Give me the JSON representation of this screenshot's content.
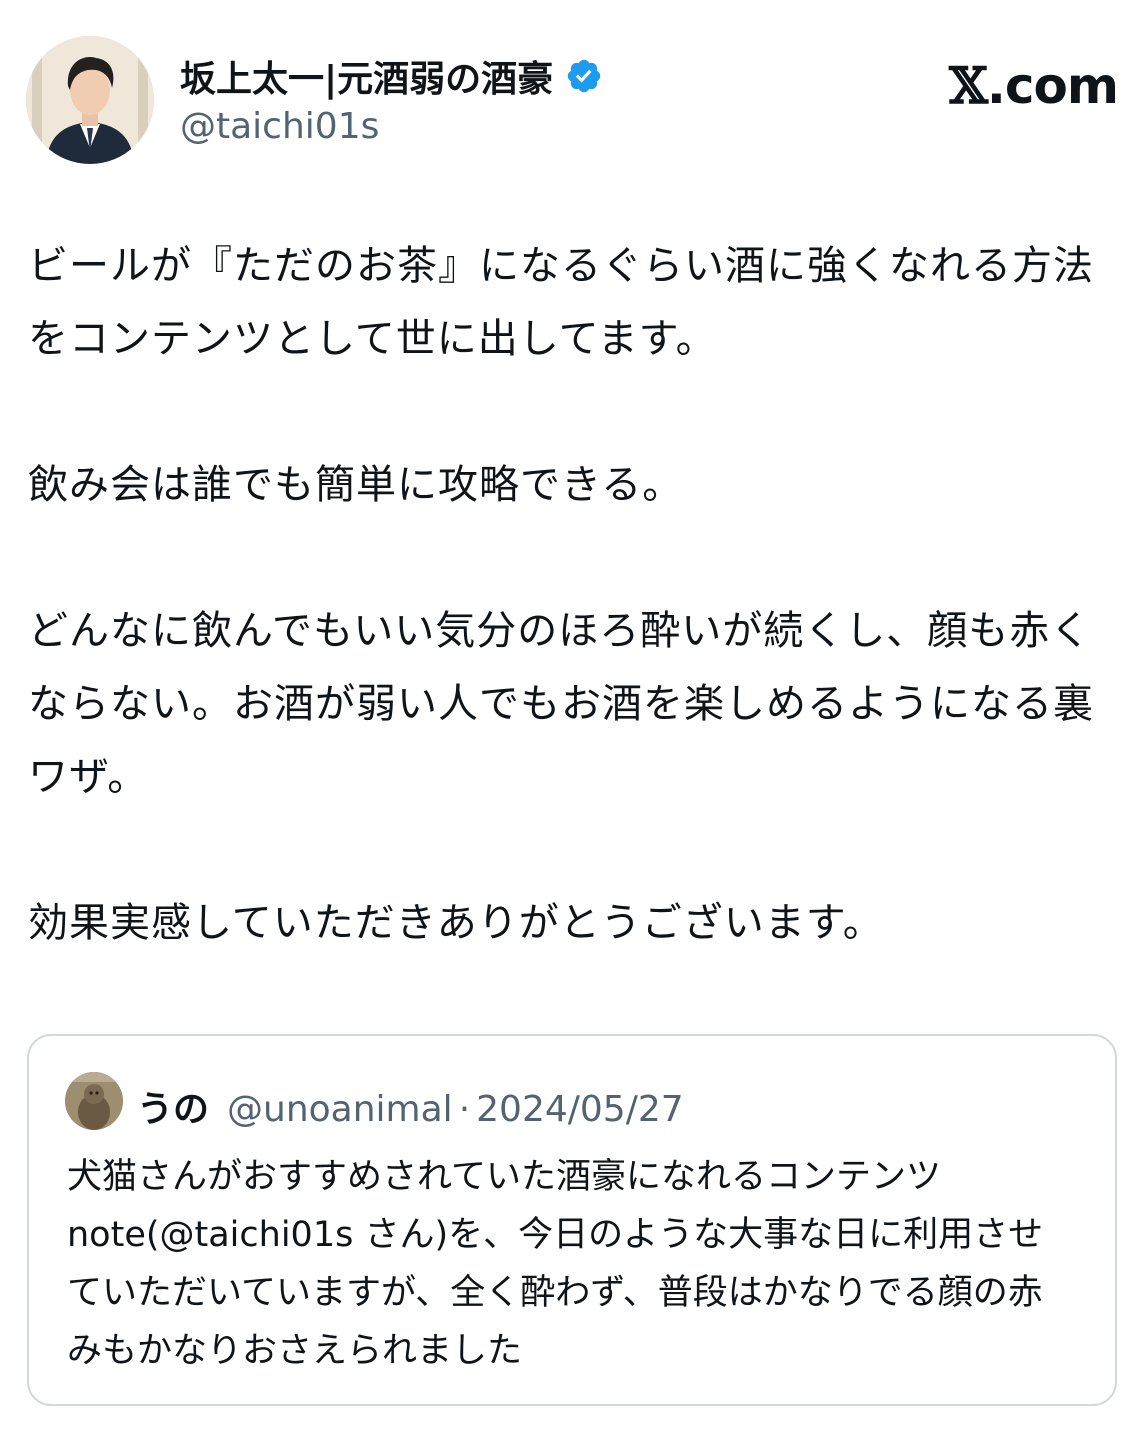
{
  "author": {
    "name": "坂上太一|元酒弱の酒豪",
    "handle": "@taichi01s",
    "verified_color": "#1d9bf0"
  },
  "brand": {
    "x_glyph": "𝕏",
    "domain": ".com"
  },
  "tweet": {
    "text": "ビールが『ただのお茶』になるぐらい酒に強くなれる方法をコンテンツとして世に出してます。\n\n飲み会は誰でも簡単に攻略できる。\n\nどんなに飲んでもいい気分のほろ酔いが続くし、顔も赤くならない。お酒が弱い人でもお酒を楽しめるようになる裏ワザ。\n\n効果実感していただきありがとうございます。"
  },
  "quoted": {
    "name": "うの",
    "handle": "@unoanimal",
    "separator": "·",
    "date": "2024/05/27",
    "text": "犬猫さんがおすすめされていた酒豪になれるコンテンツnote(@taichi01s さん)を、今日のような大事な日に利用させていただいていますが、全く酔わず、普段はかなりでる顔の赤みもかなりおさえられました"
  }
}
